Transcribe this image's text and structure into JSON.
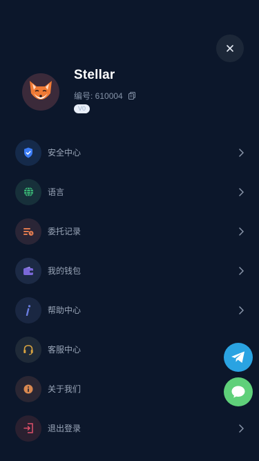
{
  "profile": {
    "username": "Stellar",
    "uid_label": "编号: 610004",
    "badge": "V0"
  },
  "menu": [
    {
      "label": "安全中心",
      "icon": "shield-icon",
      "icon_bg": "#152a4a",
      "icon_color": "#3b7cf5",
      "chevron": true
    },
    {
      "label": "语言",
      "icon": "globe-icon",
      "icon_bg": "#17303a",
      "icon_color": "#3cc07a",
      "chevron": true
    },
    {
      "label": "委托记录",
      "icon": "records-icon",
      "icon_bg": "#2a2536",
      "icon_color": "#e07a4f",
      "chevron": true
    },
    {
      "label": "我的钱包",
      "icon": "wallet-icon",
      "icon_bg": "#1c2a45",
      "icon_color": "#7a68d8",
      "chevron": true
    },
    {
      "label": "帮助中心",
      "icon": "info-italic-icon",
      "icon_bg": "#1a2742",
      "icon_color": "#6a7de0",
      "chevron": true
    },
    {
      "label": "客服中心",
      "icon": "headset-icon",
      "icon_bg": "#1f2a38",
      "icon_color": "#d9a441",
      "chevron": false
    },
    {
      "label": "关于我们",
      "icon": "info-circle-icon",
      "icon_bg": "#2a2633",
      "icon_color": "#d98850",
      "chevron": false
    },
    {
      "label": "退出登录",
      "icon": "logout-icon",
      "icon_bg": "#2a2030",
      "icon_color": "#e0506a",
      "chevron": true
    }
  ],
  "colors": {
    "background": "#0c172b",
    "telegram": "#2aa3e2",
    "chat": "#5fd07a"
  }
}
